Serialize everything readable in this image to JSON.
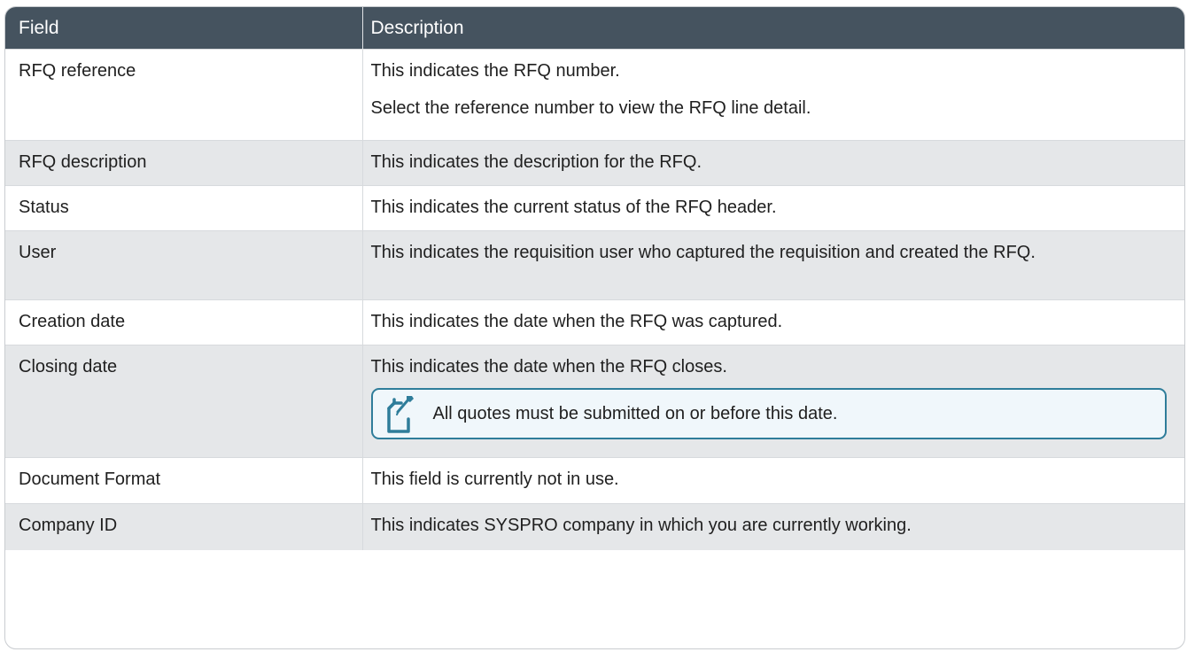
{
  "header": {
    "field": "Field",
    "description": "Description"
  },
  "rows": [
    {
      "field": "RFQ reference",
      "lines": [
        "This indicates the RFQ number.",
        "Select the reference number to view the RFQ line detail."
      ]
    },
    {
      "field": "RFQ description",
      "lines": [
        "This indicates the description for the RFQ."
      ]
    },
    {
      "field": "Status",
      "lines": [
        "This indicates the current status of the RFQ header."
      ]
    },
    {
      "field": "User",
      "lines": [
        "This indicates the requisition user who captured the requisition and created the RFQ."
      ]
    },
    {
      "field": "Creation date",
      "lines": [
        "This indicates the date when the RFQ was captured."
      ]
    },
    {
      "field": "Closing date",
      "lines": [
        "This indicates the date when the RFQ closes."
      ],
      "note": "All quotes must be submitted on or before this date."
    },
    {
      "field": "Document Format",
      "lines": [
        "This field is currently not in use."
      ]
    },
    {
      "field": "Company ID",
      "lines": [
        "This indicates SYSPRO company in which you are currently working."
      ]
    }
  ],
  "colors": {
    "header_bg": "#45535f",
    "alt_row_bg": "#e5e7e9",
    "note_border": "#2f7d9a",
    "note_bg": "#f0f7fb"
  },
  "icons": {
    "note": "note-edit-icon"
  }
}
